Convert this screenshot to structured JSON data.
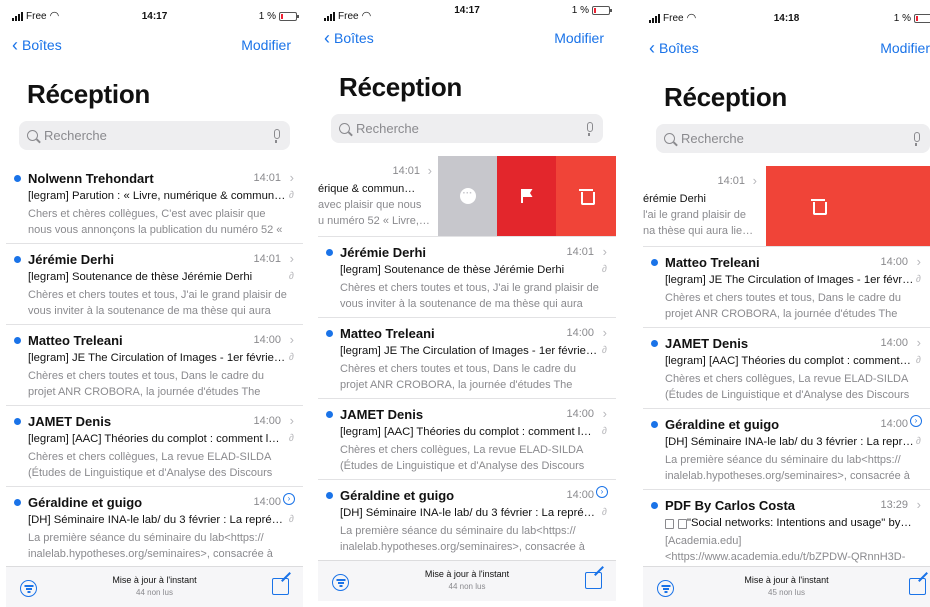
{
  "colors": {
    "accent": "#1a73e8",
    "unread_dot": "#1a73e8",
    "trash": "#f04438",
    "flag": "#e3262c",
    "more": "#c7c7cc"
  },
  "icons": {
    "back": "chevron-left-icon",
    "search": "search-icon",
    "mic": "microphone-icon",
    "filter": "filter-icon",
    "compose": "compose-icon",
    "more": "more-icon",
    "flag": "flag-icon",
    "trash": "trash-icon"
  },
  "screens": [
    {
      "status": {
        "carrier": "Free",
        "time": "14:17",
        "battery": "1 %",
        "battery_level": 0.01
      },
      "nav": {
        "back": "Boîtes",
        "edit": "Modifier"
      },
      "title": "Réception",
      "search_placeholder": "Recherche",
      "mails": [
        {
          "sender": "Nolwenn Trehondart",
          "time": "14:01",
          "subject": "[legram] Parution : « Livre, numérique & commun…",
          "preview": "Chers et chères collègues, C'est avec plaisir que nous vous annonçons la publication du numéro 52 « Livre,…"
        },
        {
          "sender": "Jérémie Derhi",
          "time": "14:01",
          "subject": "[legram] Soutenance de thèse Jérémie Derhi",
          "preview": "Chères et chers toutes et tous, J'ai le grand plaisir de vous inviter à la soutenance de ma thèse qui aura lie…"
        },
        {
          "sender": "Matteo Treleani",
          "time": "14:00",
          "subject": "[legram] JE The Circulation of Images - 1er févrie…",
          "preview": "Chères et chers toutes et tous, Dans le cadre du projet ANR CROBORA, la journée d'études The Circulation of Im…"
        },
        {
          "sender": "JAMET Denis",
          "time": "14:00",
          "subject": "[legram] [AAC] Théories du complot : comment l…",
          "preview": "Chères et chers collègues, La revue ELAD-SILDA (Études de Linguistique et d'Analyse des Discours –…"
        },
        {
          "sender": "Géraldine et guigo",
          "time": "14:00",
          "subject": "[DH] Séminaire INA-le lab/ du 3 février : La repré…",
          "preview": "La première séance du séminaire du lab<https:// inalelab.hypotheses.org/seminaires>, consacrée à l'a…"
        }
      ],
      "toolbar": {
        "status": "Mise à jour à l'instant",
        "unread": "44 non lus"
      }
    },
    {
      "status": {
        "carrier": "Free",
        "time": "14:17",
        "battery": "1 %",
        "battery_level": 0.01
      },
      "nav": {
        "back": "Boîtes",
        "edit": "Modifier"
      },
      "title": "Réception",
      "search_placeholder": "Recherche",
      "swiped": {
        "time": "14:01",
        "line1": "érique & commun…",
        "line2": "avec plaisir que nous",
        "line3": "u numéro 52 « Livre,…"
      },
      "mails": [
        {
          "sender": "Jérémie Derhi",
          "time": "14:01",
          "subject": "[legram] Soutenance de thèse Jérémie Derhi",
          "preview": "Chères et chers toutes et tous, J'ai le grand plaisir de vous inviter à la soutenance de ma thèse qui aura lie…"
        },
        {
          "sender": "Matteo Treleani",
          "time": "14:00",
          "subject": "[legram] JE The Circulation of Images - 1er févrie…",
          "preview": "Chères et chers toutes et tous, Dans le cadre du projet ANR CROBORA, la journée d'études The Circulation of Im…"
        },
        {
          "sender": "JAMET Denis",
          "time": "14:00",
          "subject": "[legram] [AAC] Théories du complot : comment l…",
          "preview": "Chères et chers collègues, La revue ELAD-SILDA (Études de Linguistique et d'Analyse des Discours –…"
        },
        {
          "sender": "Géraldine et guigo",
          "time": "14:00",
          "subject": "[DH] Séminaire INA-le lab/ du 3 février : La repré…",
          "preview": "La première séance du séminaire du lab<https:// inalelab.hypotheses.org/seminaires>, consacrée à l'a…"
        }
      ],
      "toolbar": {
        "status": "Mise à jour à l'instant",
        "unread": "44 non lus"
      }
    },
    {
      "status": {
        "carrier": "Free",
        "time": "14:18",
        "battery": "1 %",
        "battery_level": 0.01
      },
      "nav": {
        "back": "Boîtes",
        "edit": "Modifier"
      },
      "title": "Réception",
      "search_placeholder": "Recherche",
      "swiped": {
        "time": "14:01",
        "line1": "érémie Derhi",
        "line2": "l'ai le grand plaisir de",
        "line3": "na thèse qui aura lie…"
      },
      "mails": [
        {
          "sender": "Matteo Treleani",
          "time": "14:00",
          "subject": "[legram] JE The Circulation of Images - 1er févrie…",
          "preview": "Chères et chers toutes et tous, Dans le cadre du projet ANR CROBORA, la journée d'études The Circulation of Im…"
        },
        {
          "sender": "JAMET Denis",
          "time": "14:00",
          "subject": "[legram] [AAC] Théories du complot : comment l…",
          "preview": "Chères et chers collègues, La revue ELAD-SILDA (Études de Linguistique et d'Analyse des Discours –…"
        },
        {
          "sender": "Géraldine et guigo",
          "time": "14:00",
          "subject": "[DH] Séminaire INA-le lab/ du 3 février : La repré…",
          "preview": "La première séance du séminaire du lab<https:// inalelab.hypotheses.org/seminaires>, consacrée à l'a…"
        },
        {
          "sender": "PDF By Carlos Costa",
          "time": "13:29",
          "subject": "\"Social networks: Intentions and usage\" by Ca…",
          "preview": "[Academia.edu]<https://www.academia.edu/t/bZPDW-QRnnH3D-EgWUy/> …"
        }
      ],
      "toolbar": {
        "status": "Mise à jour à l'instant",
        "unread": "45 non lus"
      }
    }
  ]
}
